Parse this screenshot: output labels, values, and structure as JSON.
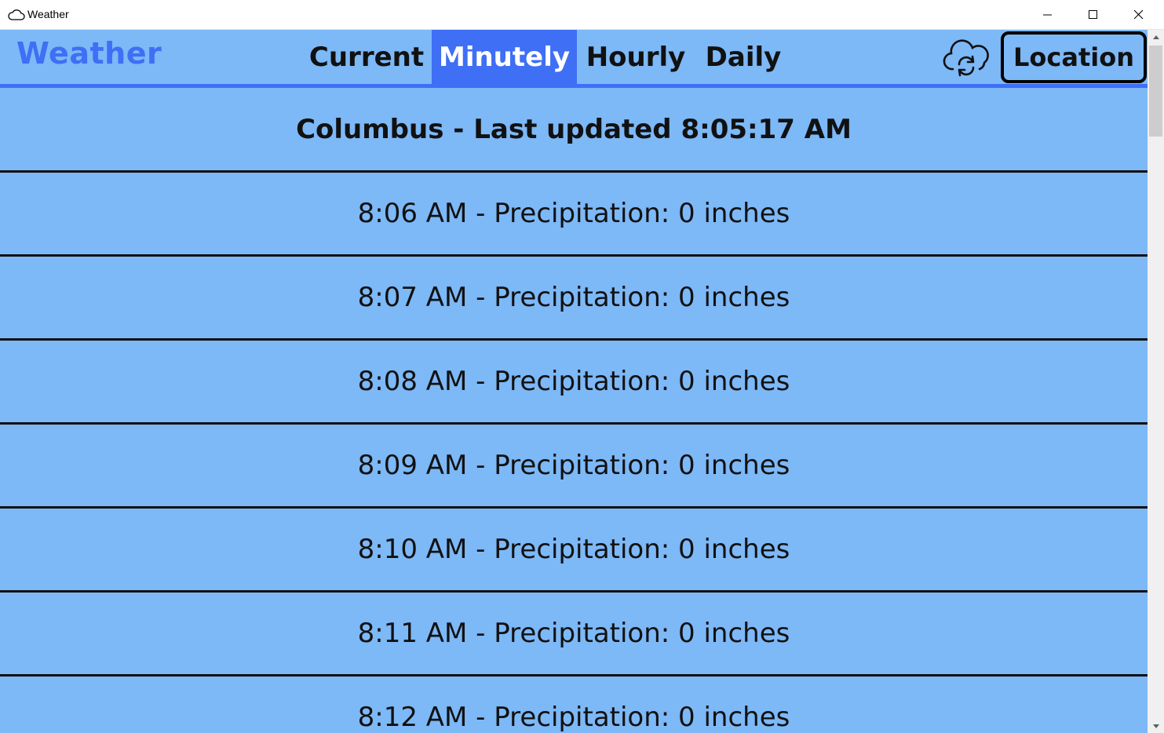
{
  "window": {
    "title": "Weather",
    "app_icon": "cloud-icon",
    "controls": [
      "minimize-icon",
      "maximize-icon",
      "close-icon"
    ]
  },
  "nav": {
    "brand": "Weather",
    "tabs": [
      {
        "label": "Current",
        "active": false
      },
      {
        "label": "Minutely",
        "active": true
      },
      {
        "label": "Hourly",
        "active": false
      },
      {
        "label": "Daily",
        "active": false
      }
    ],
    "refresh_icon": "cloud-refresh-icon",
    "location_button": "Location"
  },
  "header": "Columbus - Last updated 8:05:17 AM",
  "rows": [
    "8:06 AM - Precipitation: 0 inches",
    "8:07 AM - Precipitation: 0 inches",
    "8:08 AM - Precipitation: 0 inches",
    "8:09 AM - Precipitation: 0 inches",
    "8:10 AM - Precipitation: 0 inches",
    "8:11 AM - Precipitation: 0 inches",
    "8:12 AM - Precipitation: 0 inches"
  ],
  "colors": {
    "background": "#7db8f7",
    "accent": "#3e6ff5",
    "text": "#111111"
  }
}
